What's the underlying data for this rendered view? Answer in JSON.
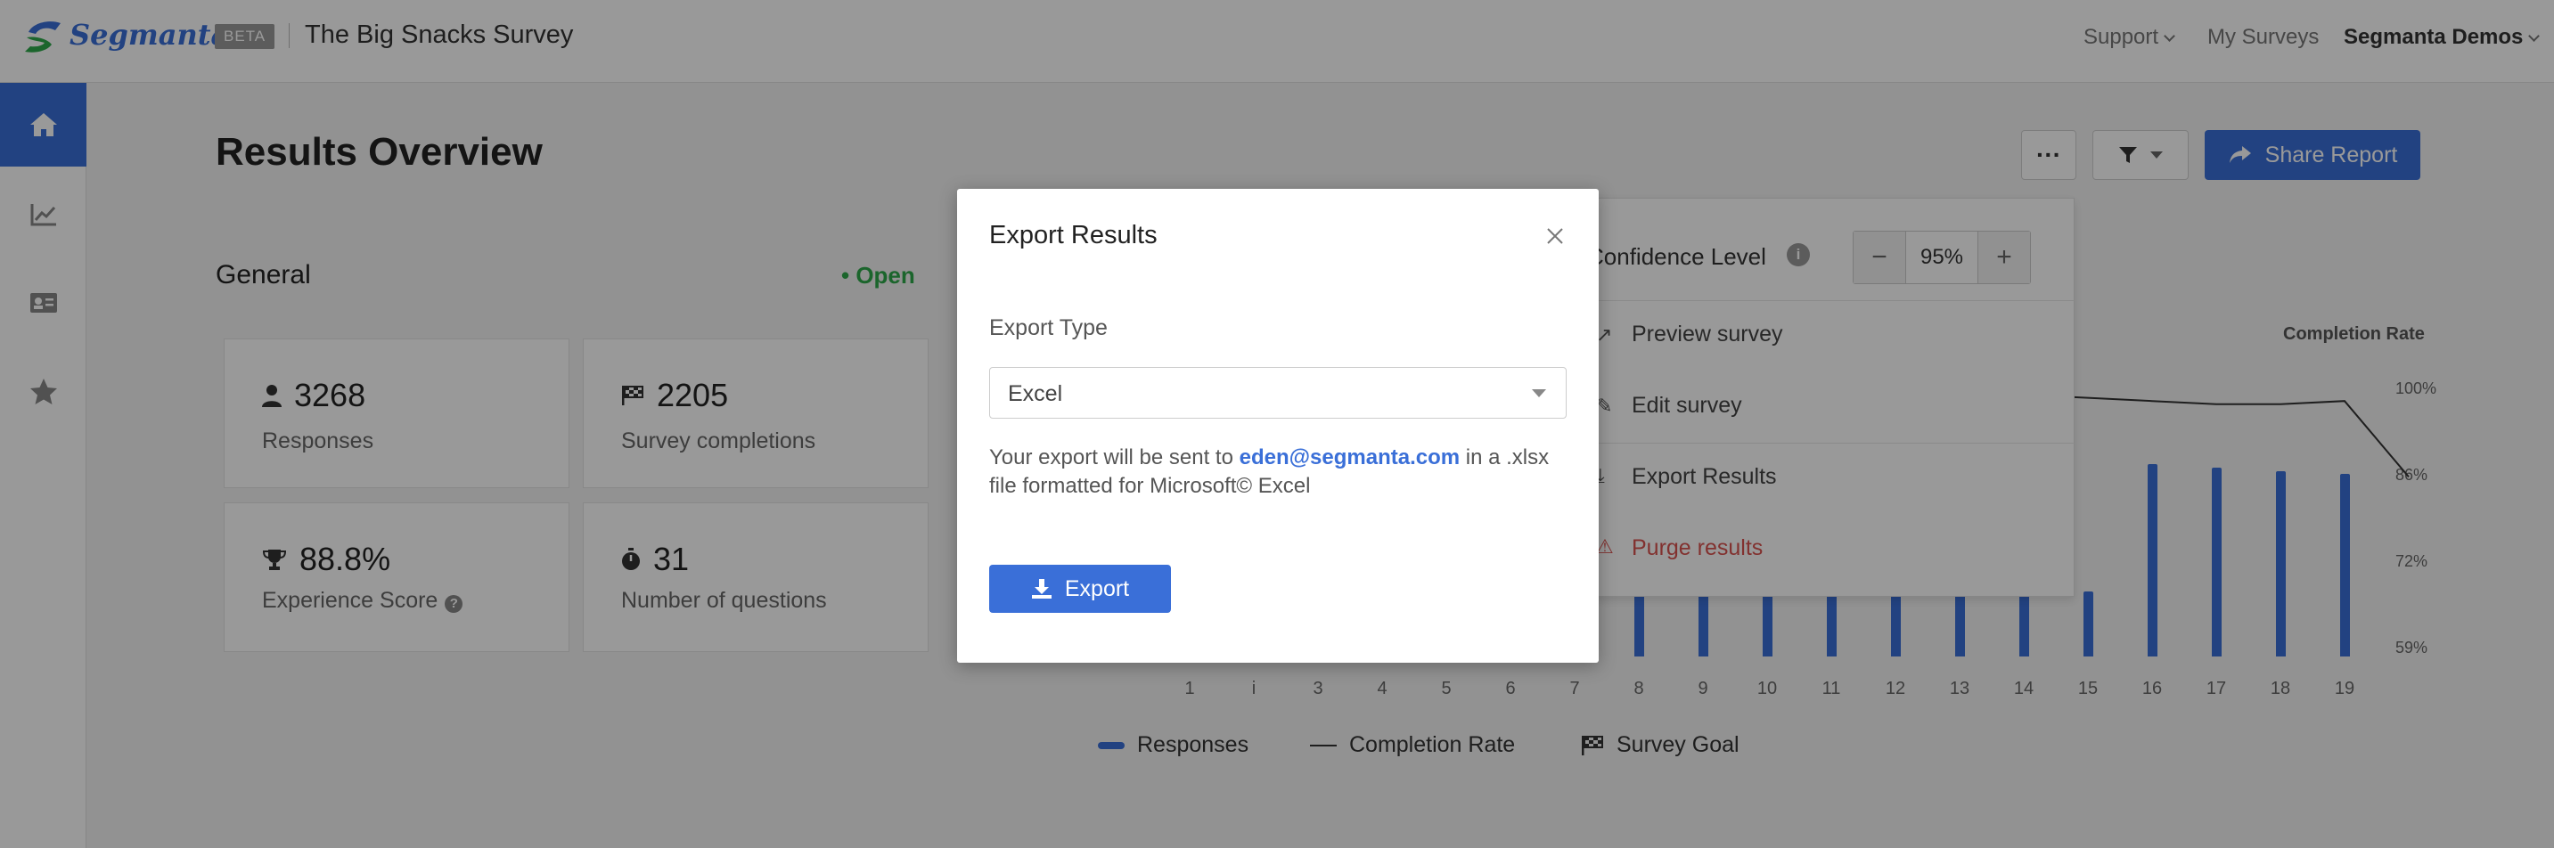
{
  "header": {
    "logo_text": "Segmanta",
    "beta_badge": "BETA",
    "survey_title": "The Big Snacks Survey",
    "nav": {
      "support": "Support",
      "my_surveys": "My Surveys",
      "account": "Segmanta Demos"
    }
  },
  "sidebar": {
    "items": [
      {
        "icon": "home-icon",
        "active": true
      },
      {
        "icon": "line-chart-icon",
        "active": false
      },
      {
        "icon": "id-card-icon",
        "active": false
      },
      {
        "icon": "star-icon",
        "active": false
      }
    ]
  },
  "main": {
    "title": "Results Overview",
    "more_label": "···",
    "share_label": "Share Report",
    "general_label": "General",
    "status": "• Open",
    "stats": [
      {
        "icon": "person-icon",
        "value": "3268",
        "label": "Responses"
      },
      {
        "icon": "flag-icon",
        "value": "2205",
        "label": "Survey completions"
      },
      {
        "icon": "trophy-icon",
        "value": "88.8%",
        "label": "Experience Score"
      },
      {
        "icon": "stopwatch-icon",
        "value": "31",
        "label": "Number of questions"
      }
    ]
  },
  "menu": {
    "confidence_label": "Confidence Level",
    "info_icon": "i",
    "confidence_value": "95%",
    "minus": "−",
    "plus": "+",
    "items": [
      {
        "label": "Preview survey",
        "icon": "external-link-icon"
      },
      {
        "label": "Edit survey",
        "icon": "pencil-icon"
      },
      {
        "label": "Export Results",
        "icon": "download-icon"
      },
      {
        "label": "Purge results",
        "icon": "warning-icon",
        "danger": true
      }
    ]
  },
  "chart_data": {
    "type": "bar",
    "title": "",
    "right_axis_label": "Completion Rate",
    "categories": [
      "1",
      "i",
      "3",
      "4",
      "5",
      "6",
      "7",
      "8",
      "9",
      "10",
      "11",
      "12",
      "13",
      "14",
      "15",
      "16",
      "17",
      "18",
      "19"
    ],
    "visible_categories_with_bars": [
      "8",
      "9",
      "10",
      "11",
      "12",
      "13",
      "14",
      "15",
      "16",
      "17",
      "18",
      "19"
    ],
    "series": [
      {
        "name": "Responses",
        "kind": "bar",
        "values": [
          null,
          null,
          null,
          null,
          null,
          null,
          null,
          2205,
          2205,
          2205,
          2205,
          2205,
          2205,
          2205,
          1100,
          3268,
          3200,
          3150,
          3100
        ]
      },
      {
        "name": "Completion Rate",
        "kind": "line",
        "values_partial_visible": [
          null,
          null,
          null,
          null,
          null,
          null,
          null,
          null,
          null,
          null,
          null,
          null,
          99,
          99,
          98.5,
          98,
          97.5,
          97.5,
          98,
          86
        ]
      }
    ],
    "right_axis_ticks": [
      "100%",
      "86%",
      "72%",
      "59%"
    ],
    "legend": [
      {
        "label": "Responses",
        "marker": "bar"
      },
      {
        "label": "Completion Rate",
        "marker": "line"
      },
      {
        "label": "Survey Goal",
        "marker": "flag"
      }
    ]
  },
  "modal": {
    "title": "Export Results",
    "type_label": "Export Type",
    "type_value": "Excel",
    "note_before": "Your export will be sent to ",
    "note_email": "eden@segmanta.com",
    "note_after": " in a .xlsx file formatted for Microsoft© Excel",
    "export_button": "Export"
  },
  "colors": {
    "accent": "#3a6fd8",
    "open_status": "#2ea84a",
    "danger": "#d9534f"
  }
}
